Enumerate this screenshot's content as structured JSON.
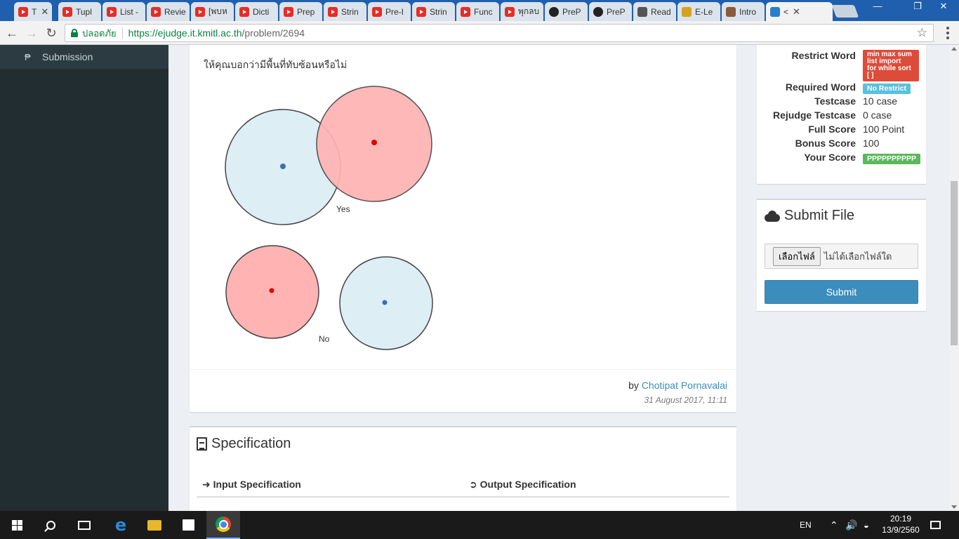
{
  "browser": {
    "tabs": [
      {
        "label": "T",
        "icon": "youtube-icon",
        "show_close": true
      },
      {
        "label": "Tupl",
        "icon": "youtube-icon"
      },
      {
        "label": "List -",
        "icon": "youtube-icon"
      },
      {
        "label": "Revie",
        "icon": "youtube-icon"
      },
      {
        "label": "[พบห",
        "icon": "youtube-icon"
      },
      {
        "label": "Dicti",
        "icon": "youtube-icon"
      },
      {
        "label": "Prep",
        "icon": "youtube-icon"
      },
      {
        "label": "Strin",
        "icon": "youtube-icon"
      },
      {
        "label": "Pre-I",
        "icon": "youtube-icon"
      },
      {
        "label": "Strin",
        "icon": "youtube-icon"
      },
      {
        "label": "Func",
        "icon": "youtube-icon"
      },
      {
        "label": "พุกลบ",
        "icon": "youtube-icon"
      },
      {
        "label": "PreP",
        "icon": "github-icon"
      },
      {
        "label": "PreP",
        "icon": "github-icon"
      },
      {
        "label": "Read",
        "icon": "book-icon"
      },
      {
        "label": "E-Le",
        "icon": "elearning-icon"
      },
      {
        "label": "Intro",
        "icon": "contact-icon"
      },
      {
        "label": "<",
        "icon": "it-icon",
        "active": true,
        "show_close": true
      }
    ],
    "address": {
      "secure_label": "ปลอดภัย",
      "url_scheme_host": "https://ejudge.it.kmitl.ac.th",
      "url_path": "/problem/2694"
    }
  },
  "sidebar": {
    "items": [
      {
        "label": "Submission",
        "icon": "submission-icon"
      }
    ]
  },
  "problem": {
    "description": "ให้คุณบอกว่ามีพื้นที่ทับซ้อนหรือไม่",
    "figure": {
      "yes_label": "Yes",
      "no_label": "No",
      "colors": {
        "blue_fill": "#ddeef5",
        "red_fill": "#ffb3b3",
        "blue_dot": "#3b6fb0",
        "red_dot": "#e00000",
        "stroke": "#444444"
      }
    },
    "by_prefix": "by",
    "author": "Chotipat Pornavalai",
    "date": "31 August 2017, 11:11"
  },
  "specification": {
    "title": "Specification",
    "input_label": "Input Specification",
    "output_label": "Output Specification"
  },
  "info": {
    "restrict_word_label": "Restrict Word",
    "restrict_word_lines": [
      "min max sum",
      "list import",
      "for while sort",
      "[ ]"
    ],
    "required_word_label": "Required Word",
    "required_word_value": "No Restrict",
    "testcase_label": "Testcase",
    "testcase_value": "10 case",
    "rejudge_label": "Rejudge Testcase",
    "rejudge_value": "0 case",
    "full_score_label": "Full Score",
    "full_score_value": "100 Point",
    "bonus_score_label": "Bonus Score",
    "bonus_score_value": "100",
    "your_score_label": "Your Score",
    "your_score_value": "PPPPPPPPPP"
  },
  "submit": {
    "title": "Submit File",
    "choose_file_label": "เลือกไฟล์",
    "no_file_label": "ไม่ได้เลือกไฟล์ใด",
    "submit_label": "Submit"
  },
  "taskbar": {
    "lang": "EN",
    "time": "20:19",
    "date": "13/9/2560"
  }
}
